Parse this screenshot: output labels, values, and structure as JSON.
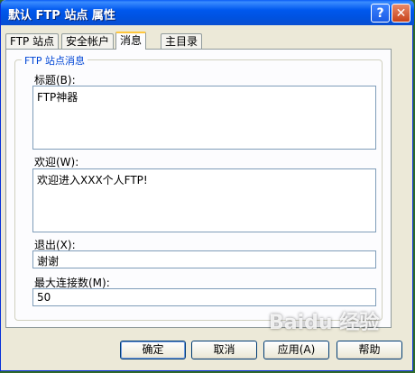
{
  "window": {
    "title": "默认 FTP 站点 属性"
  },
  "titlebar_buttons": {
    "help": "?",
    "close": "✕"
  },
  "tabs": [
    {
      "label": "FTP 站点"
    },
    {
      "label": "安全帐户"
    },
    {
      "label": "消息"
    },
    {
      "label": "主目录"
    }
  ],
  "group": {
    "title": "FTP 站点消息"
  },
  "fields": {
    "title_label": "标题(B):",
    "title_value": "FTP神器",
    "welcome_label": "欢迎(W):",
    "welcome_value": "欢迎进入XXX个人FTP!",
    "exit_label": "退出(X):",
    "exit_value": "谢谢",
    "maxconn_label": "最大连接数(M):",
    "maxconn_value": "50"
  },
  "buttons": {
    "ok": "确定",
    "cancel": "取消",
    "apply": "应用(A)",
    "help": "帮助"
  },
  "watermark": {
    "text": "Baidu 经验"
  }
}
